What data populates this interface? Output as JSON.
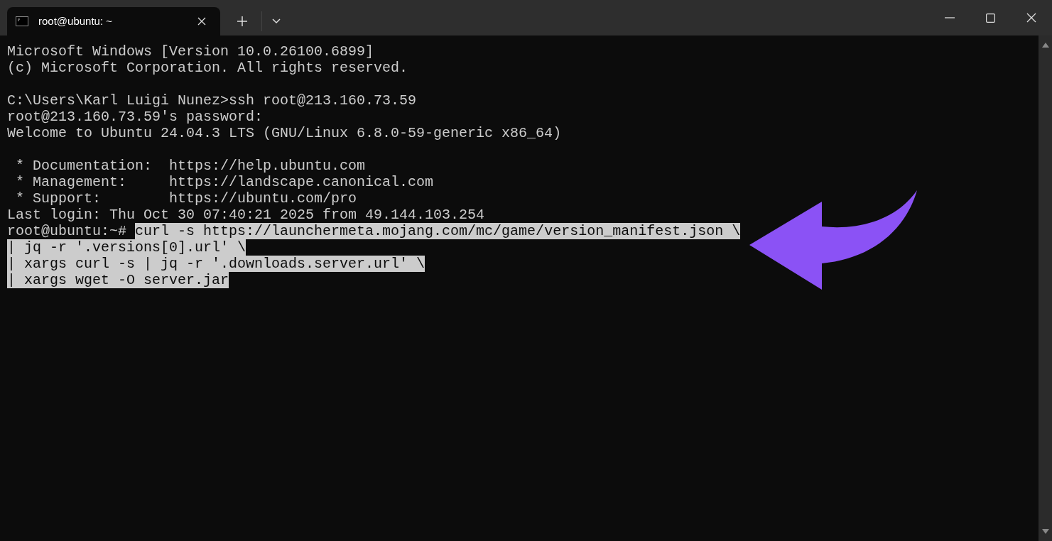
{
  "window": {
    "tab": {
      "title": "root@ubuntu: ~",
      "selected": true
    }
  },
  "blocks": [
    [
      {
        "text": "Microsoft Windows [Version 10.0.26100.6899]",
        "selected": false
      },
      {
        "text": "(c) Microsoft Corporation. All rights reserved.",
        "selected": false
      }
    ],
    [
      {
        "text": "C:\\Users\\Karl Luigi Nunez>ssh root@213.160.73.59",
        "selected": false
      },
      {
        "text": "root@213.160.73.59's password:",
        "selected": false
      },
      {
        "text": "Welcome to Ubuntu 24.04.3 LTS (GNU/Linux 6.8.0-59-generic x86_64)",
        "selected": false
      }
    ],
    [
      {
        "text": " * Documentation:  https://help.ubuntu.com",
        "selected": false
      },
      {
        "text": " * Management:     https://landscape.canonical.com",
        "selected": false
      },
      {
        "text": " * Support:        https://ubuntu.com/pro",
        "selected": false
      },
      {
        "text": "Last login: Thu Oct 30 07:40:21 2025 from 49.144.103.254",
        "selected": false
      },
      {
        "prompt": "root@ubuntu:~# ",
        "text": "curl -s https://launchermeta.mojang.com/mc/game/version_manifest.json \\",
        "selected": true
      },
      {
        "text": "| jq -r '.versions[0].url' \\",
        "selected": true
      },
      {
        "text": "| xargs curl -s | jq -r '.downloads.server.url' \\",
        "selected": true
      },
      {
        "text": "| xargs wget -O server.jar",
        "selected": true
      }
    ]
  ]
}
